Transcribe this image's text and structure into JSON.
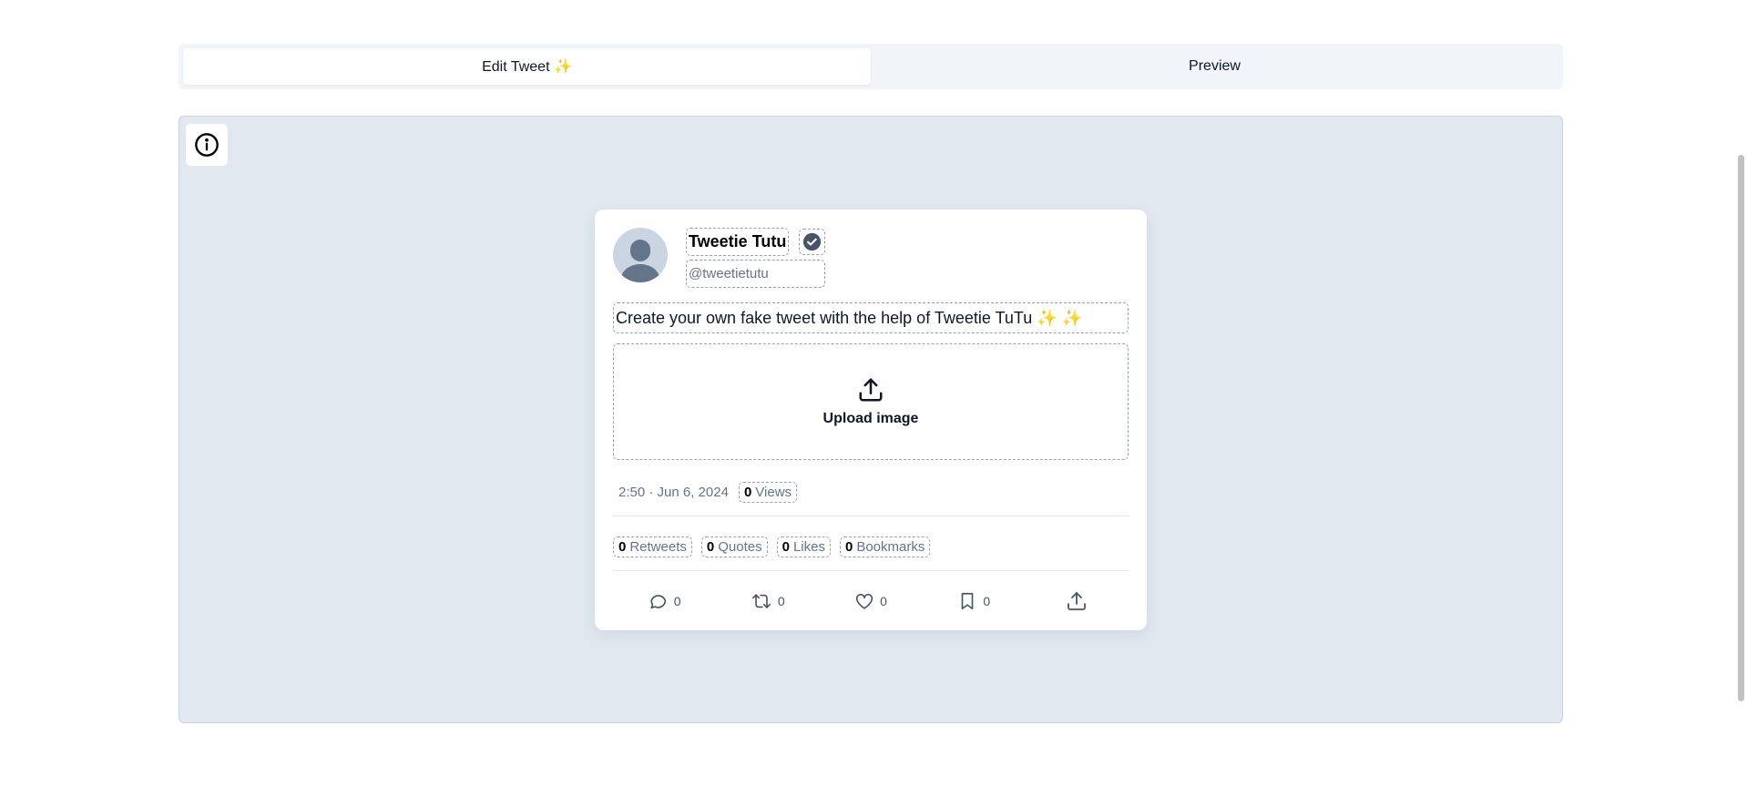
{
  "tabs": [
    {
      "label": "Edit Tweet ✨",
      "active": true
    },
    {
      "label": "Preview",
      "active": false
    }
  ],
  "info_icon": "info-circle-icon",
  "tweet": {
    "name": "Tweetie Tutu",
    "handle": "@tweetietutu",
    "verified_icon": "verified-badge-icon",
    "text": "Create your own fake tweet with the help of Tweetie TuTu ✨ ✨",
    "upload_label": "Upload image",
    "timestamp": "2:50 · Jun 6, 2024",
    "views": {
      "count": "0",
      "label": "Views"
    },
    "stats": [
      {
        "count": "0",
        "label": "Retweets"
      },
      {
        "count": "0",
        "label": "Quotes"
      },
      {
        "count": "0",
        "label": "Likes"
      },
      {
        "count": "0",
        "label": "Bookmarks"
      }
    ],
    "actions": [
      {
        "icon": "comment-icon",
        "count": "0"
      },
      {
        "icon": "retweet-icon",
        "count": "0"
      },
      {
        "icon": "heart-icon",
        "count": "0"
      },
      {
        "icon": "bookmark-icon",
        "count": "0"
      },
      {
        "icon": "share-icon",
        "count": ""
      }
    ]
  },
  "colors": {
    "canvas_bg": "#e2e8f0",
    "tabs_bg": "#f1f5f9",
    "dashed_border": "#94a3b8",
    "muted_text": "#64748b"
  }
}
